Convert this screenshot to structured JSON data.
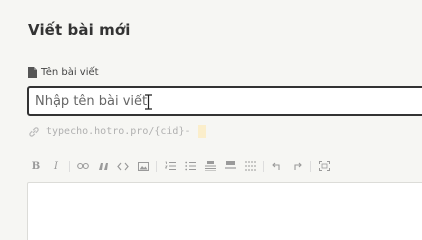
{
  "page": {
    "title": "Viết bài mới"
  },
  "title_field": {
    "label": "Tên bài viết",
    "placeholder": "Nhập tên bài viết",
    "value": ""
  },
  "slug": {
    "text": "typecho.hotro.pro/{cid}-"
  },
  "toolbar": {
    "bold": "B",
    "italic": "I",
    "buttons": [
      "bold-icon",
      "italic-icon",
      "link-icon",
      "quote-icon",
      "code-icon",
      "image-icon",
      "ordered-list-icon",
      "unordered-list-icon",
      "heading-icon",
      "horizontal-rule-icon",
      "more-icon",
      "undo-icon",
      "redo-icon",
      "fullscreen-icon"
    ]
  },
  "colors": {
    "background": "#f6f6f3",
    "input_border": "#333333",
    "slug_highlight": "#fbeecb",
    "toolbar_icon": "#9a9a9a"
  }
}
